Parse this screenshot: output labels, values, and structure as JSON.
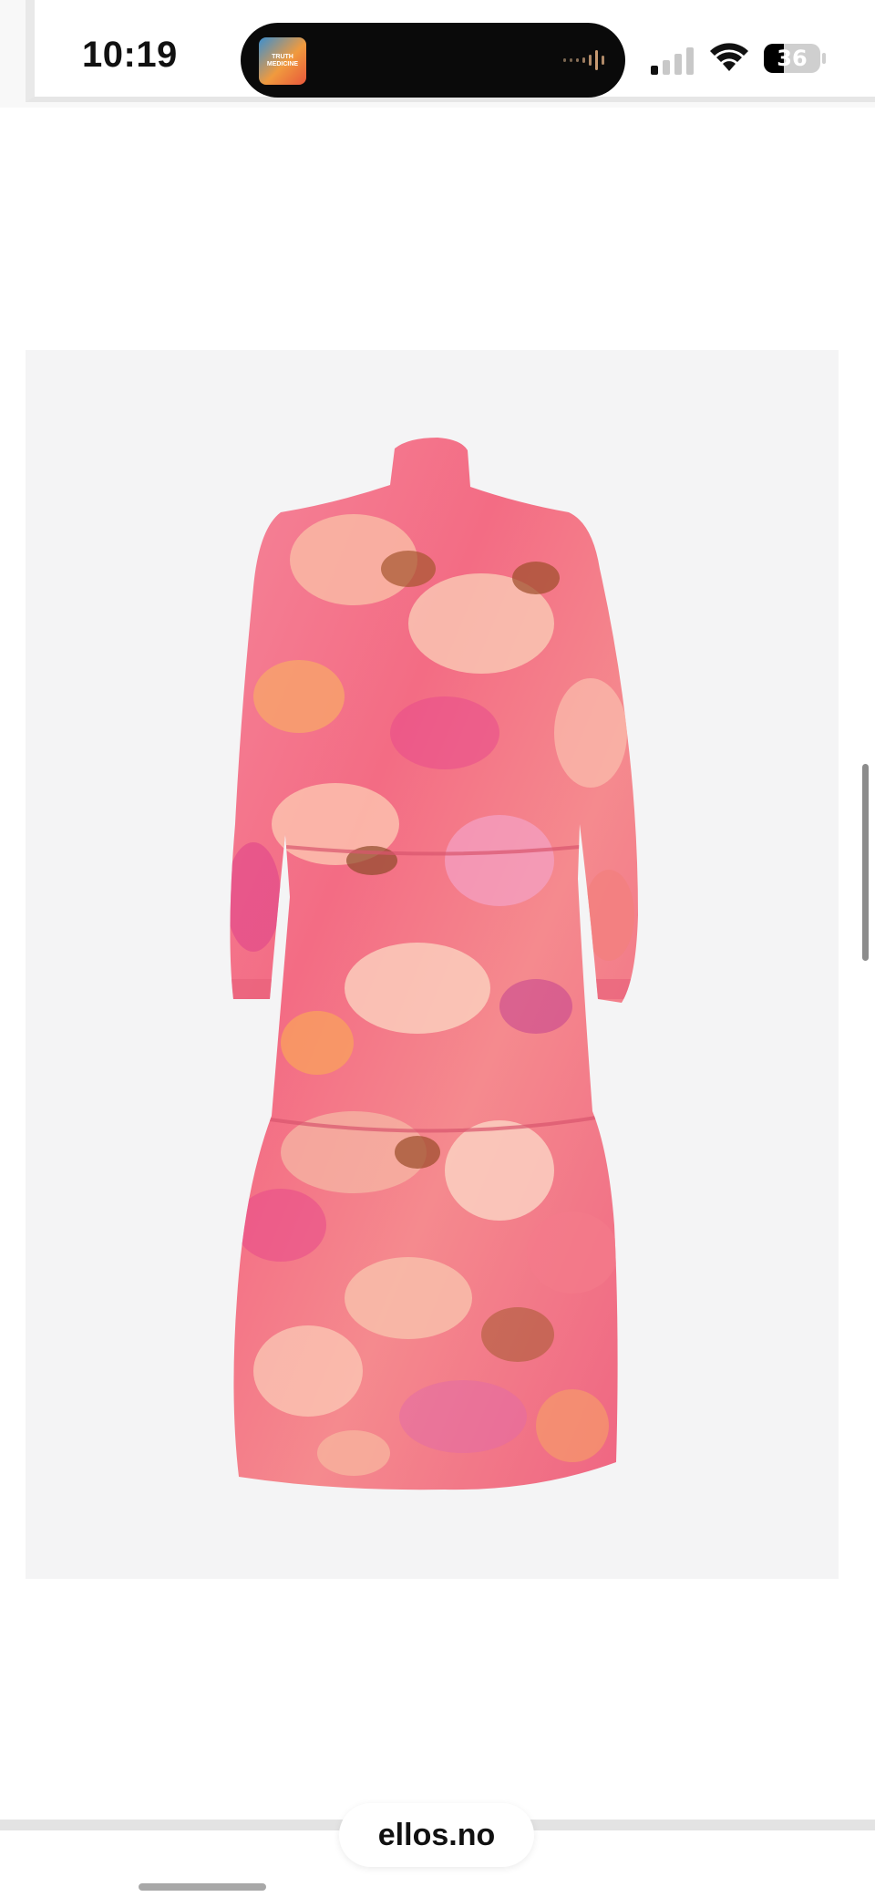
{
  "status_bar": {
    "time": "10:19",
    "now_playing_art_text": "TRUTH MEDICINE",
    "battery_level": "36",
    "battery_fraction": 0.36
  },
  "product": {
    "image_name": "floral-tiered-dress-image"
  },
  "browser": {
    "url": "ellos.no"
  },
  "colors": {
    "image_background": "#f4f4f5",
    "dress_primary": "#f2708a",
    "dress_accent": "#e84a8c"
  }
}
